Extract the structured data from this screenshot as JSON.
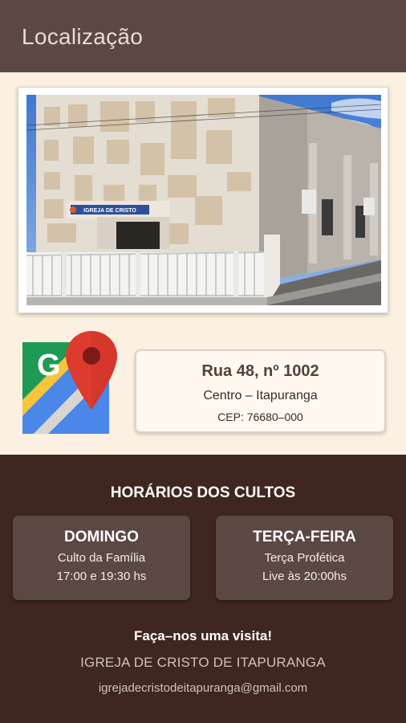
{
  "appbar": {
    "title": "Localização"
  },
  "photo": {
    "sign_text": "IGREJA DE CRISTO"
  },
  "icons": {
    "maps": "google-maps-icon"
  },
  "address": {
    "street": "Rua 48, nº 1002",
    "city": "Centro – Itapuranga",
    "cep": "CEP: 76680–000"
  },
  "schedule": {
    "title": "HORÁRIOS DOS CULTOS",
    "services": [
      {
        "day": "DOMINGO",
        "description": "Culto da Família",
        "time": "17:00 e 19:30 hs"
      },
      {
        "day": "TERÇA-FEIRA",
        "description": "Terça Profética",
        "time": "Live às 20:00hs"
      }
    ]
  },
  "footer": {
    "visit": "Faça–nos uma visita!",
    "church_name": "IGREJA DE CRISTO DE ITAPURANGA",
    "email": "igrejadecristodeitapuranga@gmail.com"
  },
  "colors": {
    "appbar": "#5b4843",
    "top_background": "#fbf0e1",
    "bottom_background": "#3f2620",
    "card": "#5b4843",
    "accent_text": "#55403a"
  }
}
